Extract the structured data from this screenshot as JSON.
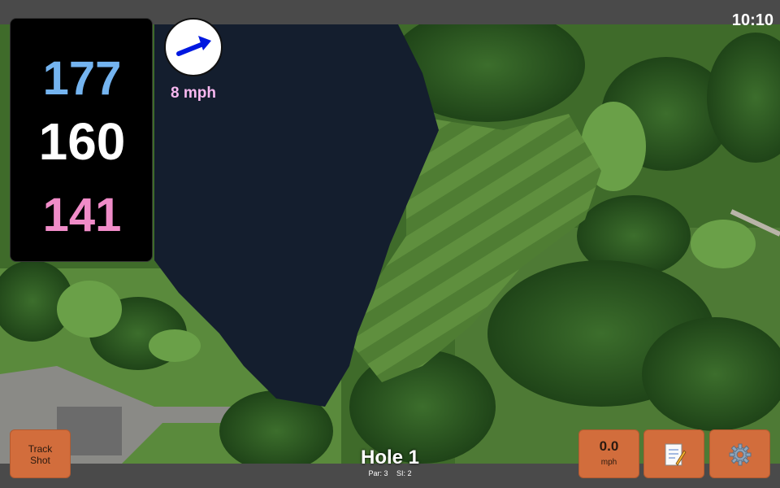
{
  "status": {
    "time": "10:10"
  },
  "distances": {
    "back": "177",
    "middle": "160",
    "front": "141"
  },
  "wind": {
    "speed_label": "8 mph",
    "icon": "wind-direction-arrow-icon"
  },
  "hole": {
    "title": "Hole 1",
    "par_label": "Par: 3",
    "si_label": "SI: 2"
  },
  "buttons": {
    "track_line1": "Track",
    "track_line2": "Shot",
    "wind_value": "0.0",
    "wind_unit": "mph",
    "notes_icon": "notepad-icon",
    "settings_icon": "gear-icon"
  },
  "colors": {
    "accent_button": "#d26d3c",
    "back_distance": "#74b4f0",
    "front_distance": "#f08cc8",
    "wind_label": "#f8b8f0"
  }
}
